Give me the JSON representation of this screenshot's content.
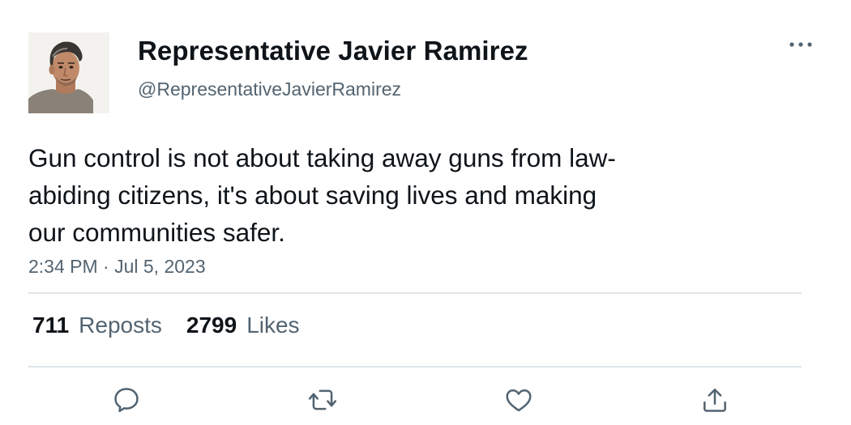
{
  "author": {
    "display_name": "Representative Javier Ramirez",
    "handle": "@RepresentativeJavierRamirez"
  },
  "tweet": {
    "text": "Gun control is not about taking away guns from law-\nabiding citizens, it's about saving lives and making\nour communities safer.",
    "timestamp": "2:34 PM · Jul 5, 2023"
  },
  "stats": {
    "reposts_count": "711",
    "reposts_label": "Reposts",
    "likes_count": "2799",
    "likes_label": "Likes"
  },
  "icons": {
    "more": "more-horizontal-icon",
    "reply": "reply-bubble-icon",
    "repost": "repost-arrows-icon",
    "like": "heart-icon",
    "share": "share-upload-icon"
  },
  "colors": {
    "text_primary": "#0f1419",
    "text_secondary": "#536471",
    "divider": "#dfe4e8"
  }
}
